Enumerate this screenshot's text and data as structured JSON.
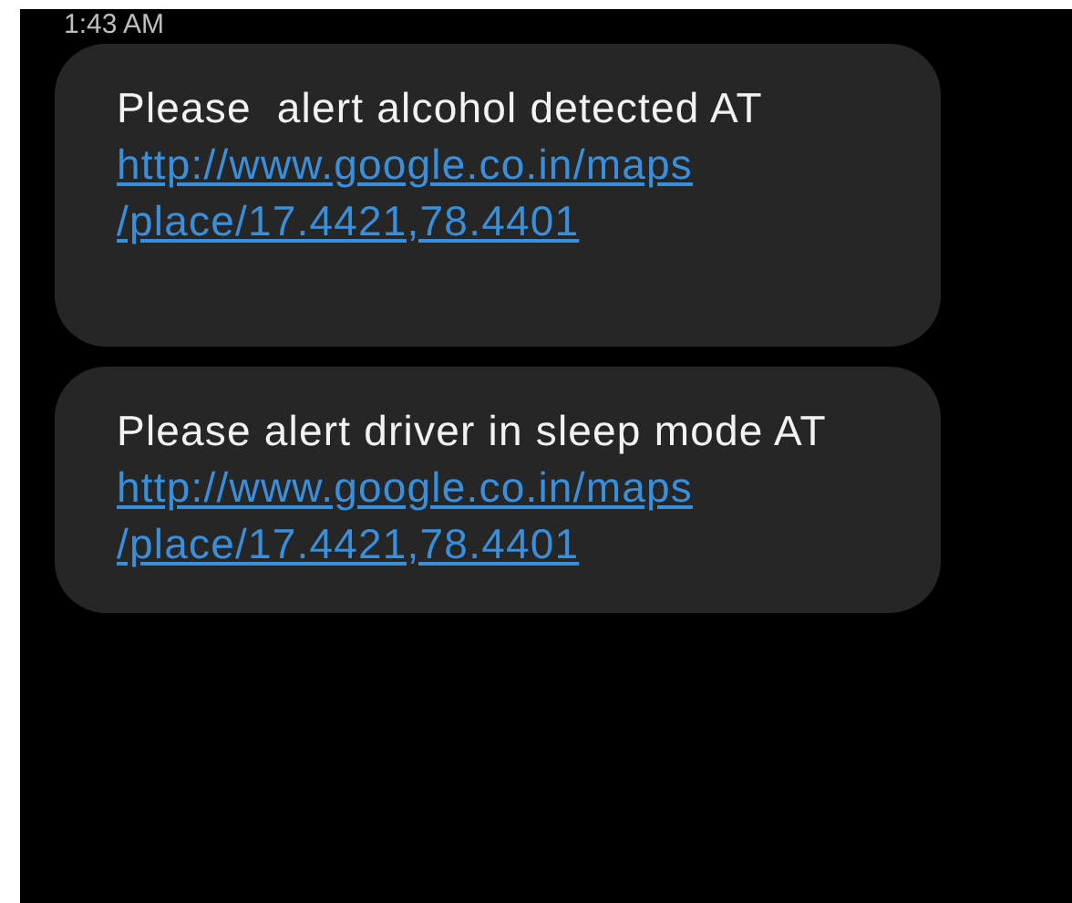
{
  "timestamp": "1:43 AM",
  "messages": [
    {
      "text": "Please  alert alcohol detected AT",
      "link_lines": [
        "http://www.google.co.in/maps",
        "/place/17.4421,78.4401"
      ]
    },
    {
      "text": "Please alert driver in sleep mode AT",
      "link_lines": [
        "http://www.google.co.in/maps",
        "/place/17.4421,78.4401"
      ]
    }
  ]
}
